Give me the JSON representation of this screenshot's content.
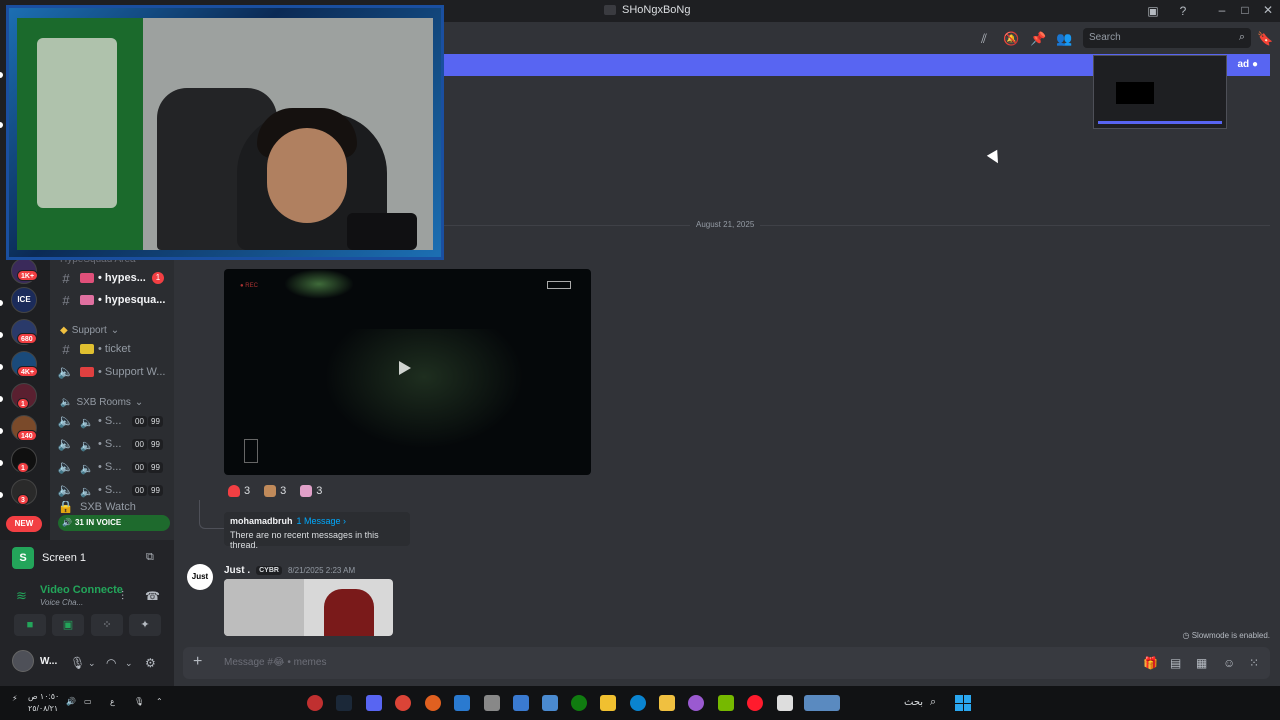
{
  "window": {
    "title": "SHoNgxBoNg"
  },
  "header": {
    "search_placeholder": "Search"
  },
  "banner": {
    "button_label": "ad"
  },
  "rail": {
    "servers": [
      {
        "label": "",
        "badge": "1K+"
      },
      {
        "label": "ICE",
        "badge": ""
      },
      {
        "label": "",
        "badge": "680"
      },
      {
        "label": "",
        "badge": "4K+"
      },
      {
        "label": "",
        "badge": "1"
      },
      {
        "label": "",
        "badge": "140"
      },
      {
        "label": "",
        "badge": "1"
      },
      {
        "label": "",
        "badge": "3"
      }
    ],
    "new_badge": "NEW"
  },
  "sidebar": {
    "category_top": "HypeSquad Area",
    "channels_top": [
      {
        "name": "• hypes...",
        "mention": "1"
      },
      {
        "name": "• hypesqua...",
        "mention": ""
      }
    ],
    "category_support": "Support",
    "channels_support": [
      {
        "name": "• ticket"
      },
      {
        "name": "• Support W..."
      }
    ],
    "category_rooms": "SXB Rooms",
    "rooms": [
      {
        "name": "• S...",
        "a": "00",
        "b": "99"
      },
      {
        "name": "• S...",
        "a": "00",
        "b": "99"
      },
      {
        "name": "• S...",
        "a": "00",
        "b": "99"
      },
      {
        "name": "• S...",
        "a": "00",
        "b": "99"
      }
    ],
    "watch_channel": "SXB Watch",
    "voice_pill": "31 IN VOICE"
  },
  "voice_panel": {
    "screen_label": "Screen 1",
    "screen_icon_letter": "S",
    "connection_title": "Video Connecte",
    "connection_sub": "Voice Cha...",
    "user_name": "W..."
  },
  "chat": {
    "date_divider": "August 21, 2025",
    "reactions": [
      {
        "count": "3",
        "color": "#f23f43"
      },
      {
        "count": "3",
        "color": "#c08a5a"
      },
      {
        "count": "3",
        "color": "#e0a0c8"
      }
    ],
    "thread": {
      "author": "mohamadbruh",
      "link": "1 Message ›",
      "empty": "There are no recent messages in this thread."
    },
    "message": {
      "avatar_text": "Just",
      "author": "Just .",
      "tag": "CYBR",
      "timestamp": "8/21/2025 2:23 AM"
    },
    "slowmode": "Slowmode is enabled.",
    "composer_placeholder": "Message #😂 • memes"
  },
  "taskbar": {
    "clock_time": "١٠:٥٠ ص",
    "clock_date": "٢٥/٠٨/٢١",
    "lang": "ع",
    "search_label": "بحث"
  }
}
